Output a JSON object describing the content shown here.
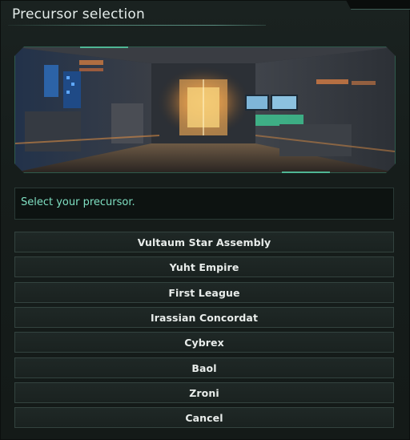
{
  "dialog": {
    "title": "Precursor selection",
    "banner_icon": "space-station-interior-image",
    "prompt": "Select your precursor.",
    "options": [
      {
        "label": "Vultaum Star Assembly"
      },
      {
        "label": "Yuht Empire"
      },
      {
        "label": "First League"
      },
      {
        "label": "Irassian Concordat"
      },
      {
        "label": "Cybrex"
      },
      {
        "label": "Baol"
      },
      {
        "label": "Zroni"
      },
      {
        "label": "Cancel"
      }
    ]
  },
  "colors": {
    "accent": "#7fe0c2",
    "frame": "#2f5a4c",
    "background": "#161d1b",
    "button_border": "#33433f",
    "text": "#e8ecea"
  }
}
